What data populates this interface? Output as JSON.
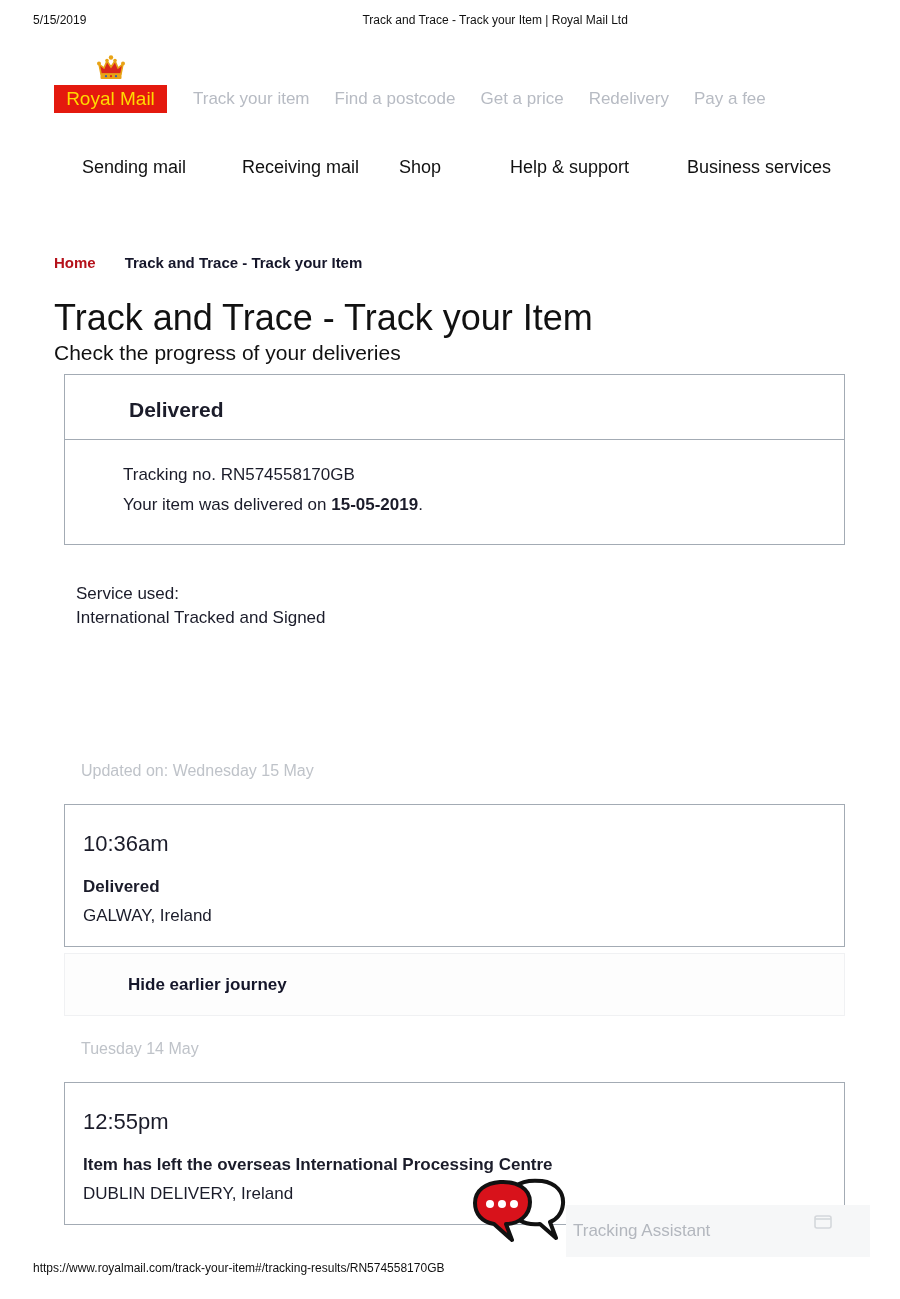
{
  "print_header": {
    "date": "5/15/2019",
    "title": "Track and Trace - Track your Item | Royal Mail Ltd"
  },
  "logo": {
    "text": "Royal Mail"
  },
  "top_nav": [
    "Track your item",
    "Find a postcode",
    "Get a price",
    "Redelivery",
    "Pay a fee"
  ],
  "main_nav": [
    "Sending mail",
    "Receiving mail",
    "Shop",
    "Help & support",
    "Business services"
  ],
  "breadcrumb": [
    {
      "label": "Home",
      "kind": "link"
    },
    {
      "label": "Track and Trace - Track your Item",
      "kind": "current"
    }
  ],
  "page": {
    "title": "Track and Trace - Track your Item",
    "subtitle": "Check the progress of your deliveries"
  },
  "status_card": {
    "status": "Delivered",
    "tracking_line": "Tracking no. RN574558170GB",
    "delivered_line": "Your item was delivered on **15-05-2019**."
  },
  "service": {
    "label": "Service used:",
    "value": "International Tracked and Signed"
  },
  "journey": [
    {
      "kind": "date",
      "text": "Updated on: Wednesday 15 May"
    },
    {
      "kind": "event",
      "time": "10:36am",
      "status": "Delivered",
      "location": "GALWAY, Ireland"
    },
    {
      "kind": "toggle",
      "label": "Hide earlier journey"
    },
    {
      "kind": "date",
      "text": "Tuesday 14 May"
    },
    {
      "kind": "event",
      "time": "12:55pm",
      "status": "Item has left the overseas International Processing Centre",
      "location": "DUBLIN DELIVERY, Ireland"
    }
  ],
  "assistant": {
    "label": "Tracking Assistant"
  },
  "print_footer": {
    "url": "https://www.royalmail.com/track-your-item#/tracking-results/RN574558170GB"
  }
}
